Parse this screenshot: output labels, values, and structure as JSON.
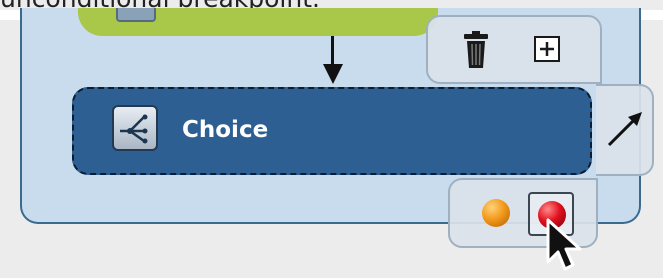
{
  "caption": {
    "text": "unconditional breakpoint."
  },
  "node": {
    "label": "Choice",
    "icon": "choice-branch-icon"
  },
  "toolbar": {
    "icons": [
      "trash-icon",
      "plus-box-icon",
      "connect-arrow-icon"
    ]
  },
  "breakpoints": {
    "icons": [
      "orange-breakpoint-icon",
      "red-breakpoint-icon"
    ]
  },
  "colors": {
    "node_fill": "#2e5f93",
    "previous_node_fill": "#a9c84a",
    "panel_fill": "#c8dced",
    "orange_breakpoint": "#f39a1c",
    "red_breakpoint": "#e0101e"
  }
}
